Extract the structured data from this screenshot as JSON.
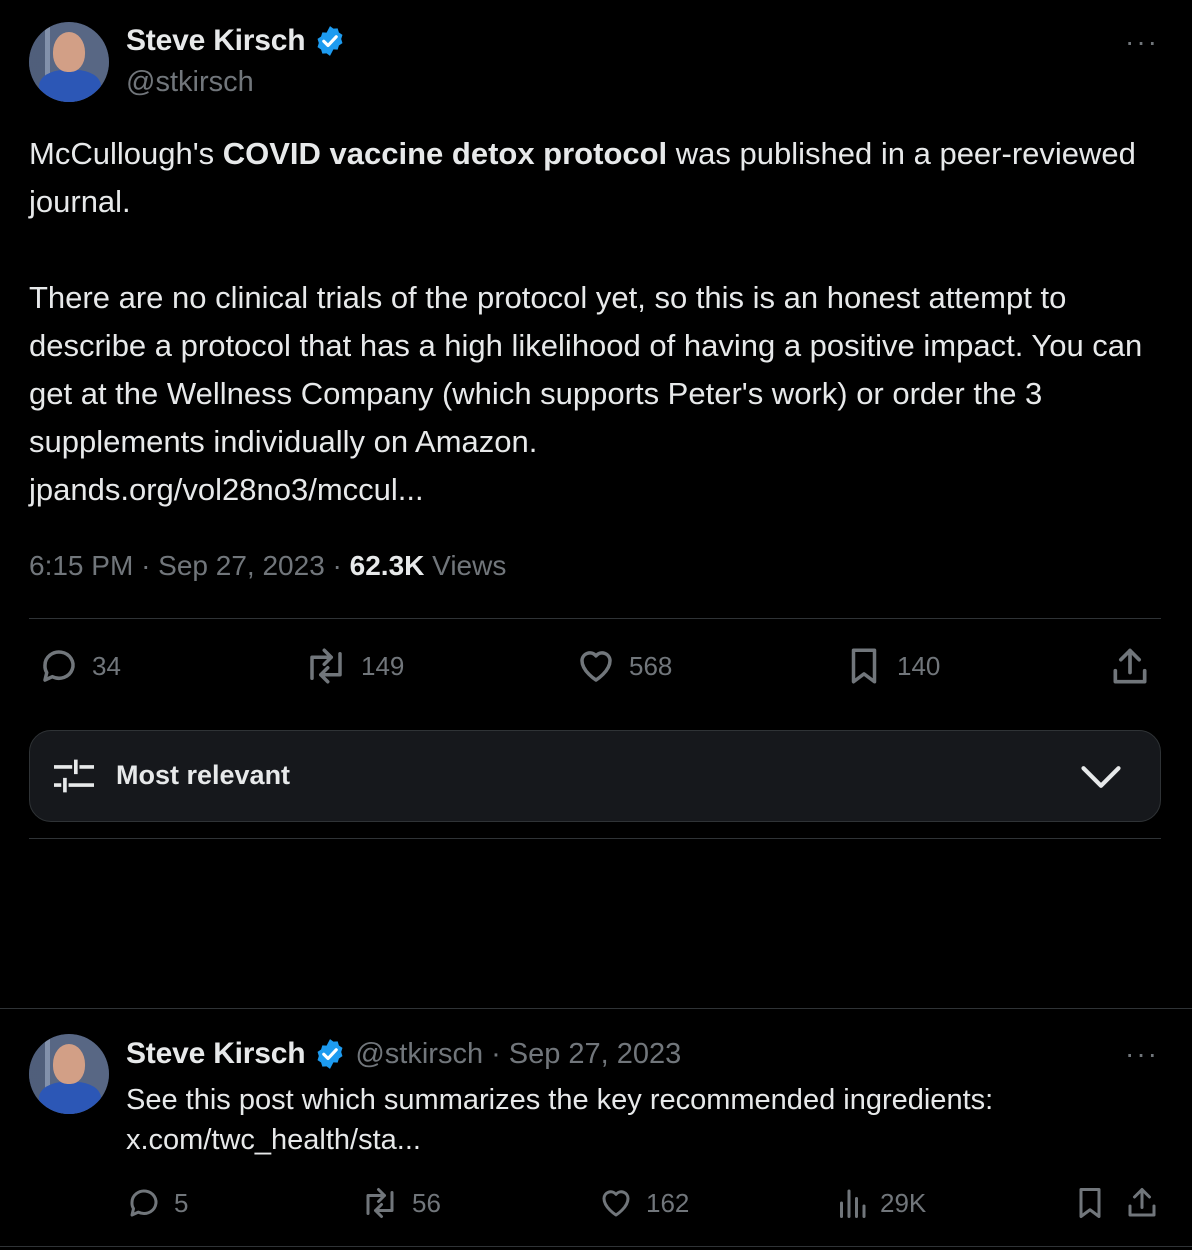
{
  "main_tweet": {
    "author_name": "Steve Kirsch",
    "author_handle": "@stkirsch",
    "more_label": "···",
    "text_part1": "McCullough's ",
    "text_bold": "COVID vaccine detox protocol",
    "text_part2": " was published in a peer-reviewed journal.",
    "text_paragraph2": "There are no clinical trials of the protocol yet, so this is an honest attempt to describe a protocol that has a high likelihood of having a positive impact. You can get at the Wellness Company (which supports Peter's work) or order the 3 supplements individually on Amazon.",
    "link_text": "jpands.org/vol28no3/mccul...",
    "time": "6:15 PM",
    "date": "Sep 27, 2023",
    "views_count": "62.3K",
    "views_label": "Views",
    "replies": "34",
    "reposts": "149",
    "likes": "568",
    "bookmarks": "140"
  },
  "sort": {
    "label": "Most relevant"
  },
  "reply_tweet": {
    "author_name": "Steve Kirsch",
    "author_handle": "@stkirsch",
    "separator": "·",
    "date": "Sep 27, 2023",
    "more_label": "···",
    "text": "See this post which summarizes the key recommended ingredients:",
    "link_text": "x.com/twc_health/sta...",
    "replies": "5",
    "reposts": "56",
    "likes": "162",
    "views": "29K"
  },
  "colors": {
    "background": "#000000",
    "text": "#e7e9ea",
    "muted": "#71767b",
    "link": "#1d9bf0",
    "verified": "#1d9bf0",
    "divider": "#2f3336"
  },
  "icons": {
    "verified": "verified-badge-icon",
    "reply": "reply-icon",
    "repost": "repost-icon",
    "like": "heart-icon",
    "bookmark": "bookmark-icon",
    "share": "share-icon",
    "views": "views-bar-chart-icon",
    "sort": "sliders-icon",
    "chevron": "chevron-down-icon"
  }
}
